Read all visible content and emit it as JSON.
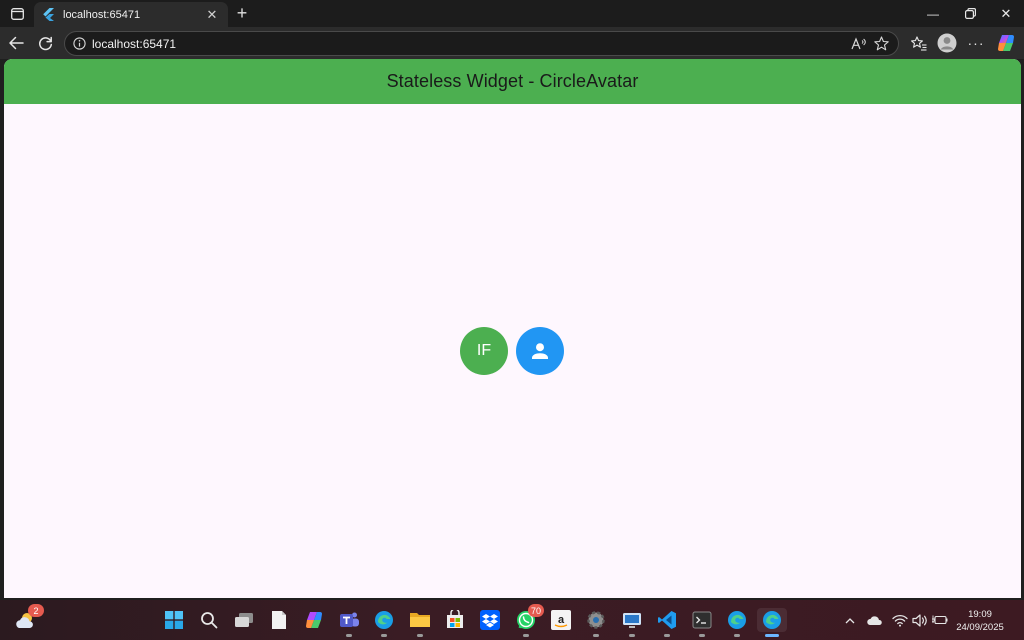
{
  "browser": {
    "tab": {
      "title": "localhost:65471",
      "close_glyph": "✕"
    },
    "newtab_glyph": "+",
    "url": "localhost:65471",
    "controls": {
      "minimize": "—",
      "close": "✕"
    }
  },
  "app": {
    "appbar_title": "Stateless Widget - CircleAvatar",
    "avatar_initials": "IF",
    "colors": {
      "appbar": "#4caf50",
      "avatar_green": "#4caf50",
      "avatar_blue": "#2196f3",
      "background": "#fef7fe"
    }
  },
  "taskbar": {
    "weather_badge": "2",
    "whatsapp_badge": "70",
    "time": "19:09",
    "date": "24/09/2025"
  },
  "icons": [
    "sidebar-icon",
    "flutter-favicon",
    "back-arrow-icon",
    "refresh-icon",
    "info-icon",
    "read-aloud-icon",
    "favorite-star-icon",
    "favorites-icon",
    "profile-icon",
    "more-icon",
    "copilot-icon",
    "person-icon"
  ]
}
